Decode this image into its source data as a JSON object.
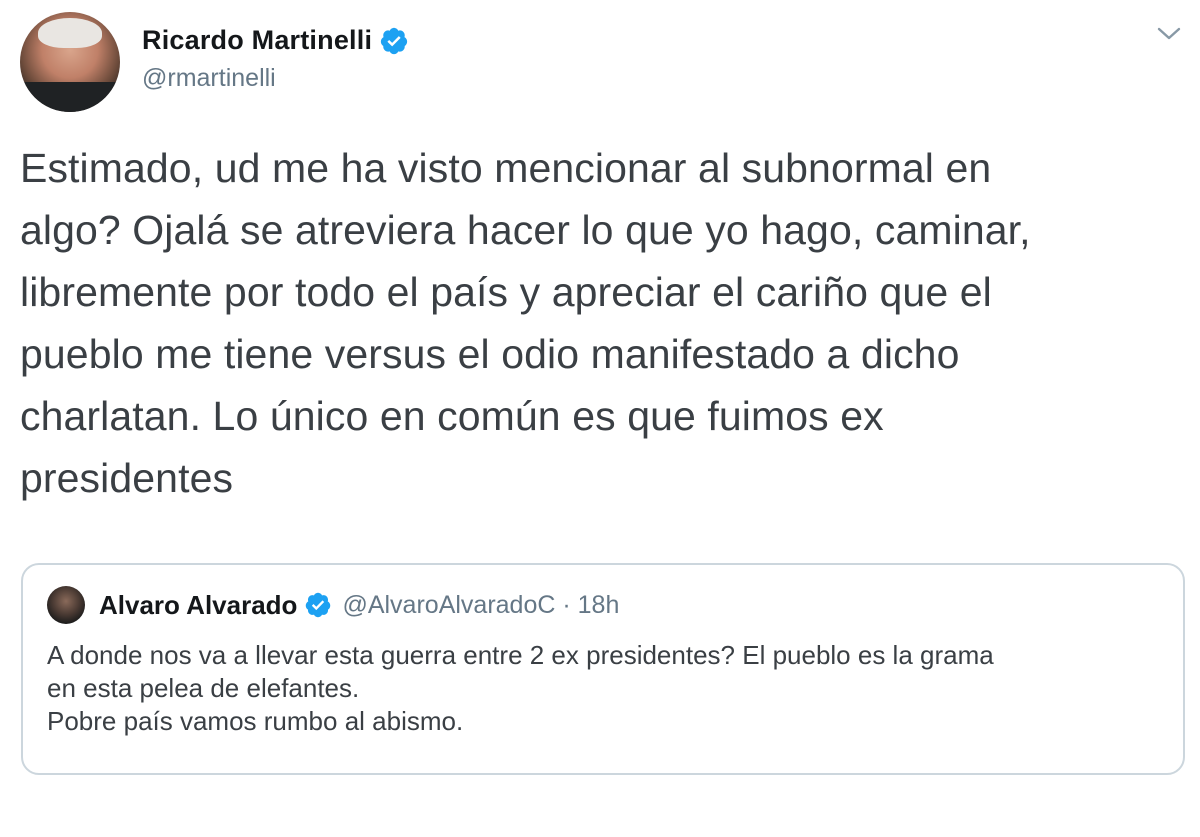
{
  "tweet": {
    "author": {
      "name": "Ricardo Martinelli",
      "handle": "@rmartinelli",
      "verified": true
    },
    "lines": [
      "Estimado, ud me ha visto mencionar al subnormal en",
      "algo? Ojalá se atreviera hacer lo que yo hago, caminar,",
      "libremente por todo el país y apreciar el cariño que el",
      "pueblo me tiene versus el odio manifestado a dicho",
      "charlatan. Lo único en común es que fuimos ex",
      "presidentes"
    ]
  },
  "quoted": {
    "name": "Alvaro Alvarado",
    "handle_time": "@AlvaroAlvaradoC · 18h",
    "verified": true,
    "lines": [
      "A donde nos va a llevar esta guerra entre 2 ex presidentes? El pueblo es la grama",
      "en esta pelea de elefantes.",
      "Pobre país vamos rumbo al abismo."
    ]
  },
  "colors": {
    "verified_blue": "#1da1f2",
    "secondary_text": "#657786",
    "border": "#ccd6dd"
  },
  "icons": {
    "more": "chevron-down-icon",
    "verified": "verified-badge-icon"
  }
}
